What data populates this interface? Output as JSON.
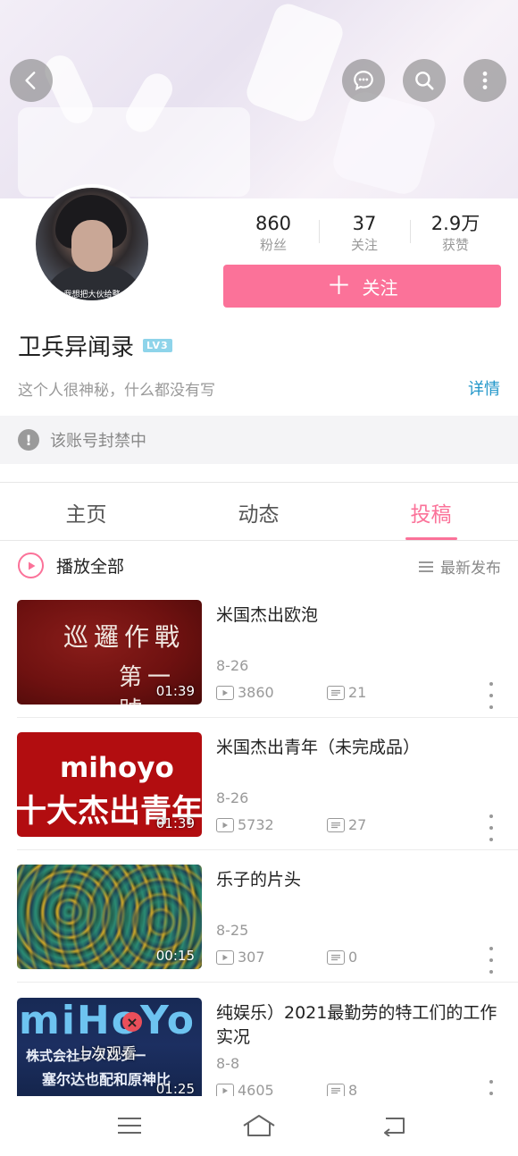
{
  "header": {
    "back_icon": "chevron-left-icon",
    "actions": [
      "chat-bubble-icon",
      "search-icon",
      "more-vertical-icon"
    ]
  },
  "profile": {
    "avatar_caption": "我想把大伙给整",
    "stats": [
      {
        "value": "860",
        "label": "粉丝"
      },
      {
        "value": "37",
        "label": "关注"
      },
      {
        "value": "2.9万",
        "label": "获赞"
      }
    ],
    "follow_label": "关注",
    "username": "卫兵异闻录",
    "level": "LV3",
    "bio": "这个人很神秘，什么都没有写",
    "detail_link": "详情",
    "ban_notice": "该账号封禁中"
  },
  "tabs": [
    {
      "label": "主页",
      "active": false
    },
    {
      "label": "动态",
      "active": false
    },
    {
      "label": "投稿",
      "active": true
    }
  ],
  "list_header": {
    "play_all": "播放全部",
    "sort_label": "最新发布"
  },
  "videos": [
    {
      "title": "米国杰出欧泡",
      "date": "8-26",
      "views": "3860",
      "comments": "21",
      "duration": "01:39",
      "thumb_text_a": "巡邏作戰",
      "thumb_text_b": "第一號"
    },
    {
      "title": "米国杰出青年（未完成品）",
      "date": "8-26",
      "views": "5732",
      "comments": "27",
      "duration": "01:39",
      "thumb_text_a": "mihoyo",
      "thumb_text_b": "十大杰出青年"
    },
    {
      "title": "乐子的片头",
      "date": "8-25",
      "views": "307",
      "comments": "0",
      "duration": "00:15"
    },
    {
      "title": "纯娱乐）2021最勤劳的特工们的工作实况",
      "date": "8-8",
      "views": "4605",
      "comments": "8",
      "duration": "01:25",
      "thumb_text_a": "miHoYo",
      "thumb_text_b": "株式会社ヲヲロジー",
      "thumb_text_c": "塞尔达也配和原神比",
      "watched_label": "上次观看"
    }
  ],
  "bottom_nav": [
    "menu-icon",
    "home-icon",
    "back-icon"
  ],
  "colors": {
    "accent": "#fb7299",
    "link": "#2196c9",
    "level_badge": "#8ed4ea"
  }
}
